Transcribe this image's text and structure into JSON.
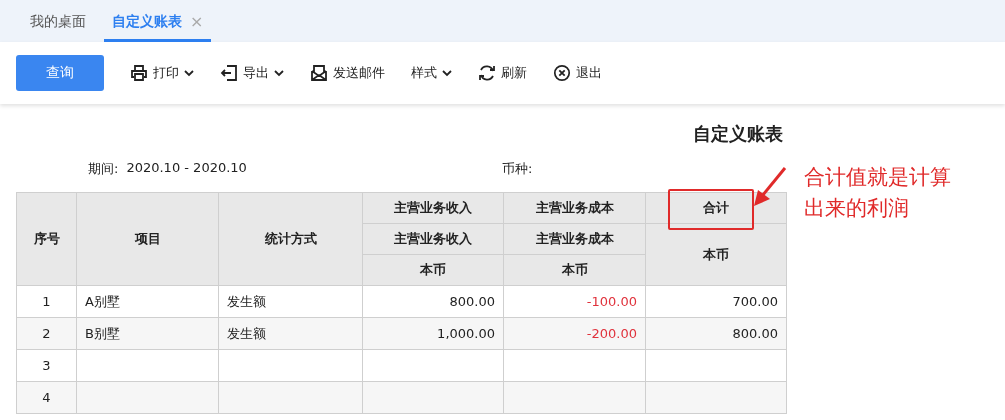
{
  "tabs": [
    {
      "label": "我的桌面",
      "selected": false
    },
    {
      "label": "自定义账表",
      "selected": true,
      "close": "×"
    }
  ],
  "toolbar": [
    {
      "kind": "primary",
      "label": "查询"
    },
    {
      "kind": "print",
      "label": "打印",
      "dropdown": true
    },
    {
      "kind": "export",
      "label": "导出",
      "dropdown": true
    },
    {
      "kind": "mail",
      "label": "发送邮件",
      "dropdown": false
    },
    {
      "kind": "plain",
      "label": "样式",
      "dropdown": true
    },
    {
      "kind": "refresh",
      "label": "刷新",
      "dropdown": false
    },
    {
      "kind": "exit",
      "label": "退出",
      "dropdown": false
    }
  ],
  "report": {
    "title": "自定义账表",
    "period_label": "期间:",
    "period": "2020.10 - 2020.10",
    "currency_label": "币种:"
  },
  "table": {
    "columns": [
      "序号",
      "项目",
      "统计方式"
    ],
    "groups": [
      {
        "top": "主营业务收入",
        "middle": "主营业务收入",
        "bottom": "本币"
      },
      {
        "top": "主营业务成本",
        "middle": "主营业务成本",
        "bottom": "本币"
      },
      {
        "top": "合计",
        "bottom": "本币",
        "highlighted": true
      }
    ],
    "rows": [
      {
        "no": "1",
        "cells": [
          {
            "text": "A别墅"
          },
          {
            "text": "发生额"
          },
          {
            "text": "800.00"
          },
          {
            "text": "-100.00",
            "color": "#e0323c"
          },
          {
            "text": "700.00"
          }
        ]
      },
      {
        "no": "2",
        "cells": [
          {
            "text": "B别墅"
          },
          {
            "text": "发生额"
          },
          {
            "text": "1,000.00"
          },
          {
            "text": "-200.00",
            "color": "#e0323c"
          },
          {
            "text": "800.00"
          }
        ]
      },
      {
        "no": "3"
      },
      {
        "no": "4"
      }
    ]
  },
  "annotation": {
    "text": "合计值就是计算出来的利润"
  }
}
